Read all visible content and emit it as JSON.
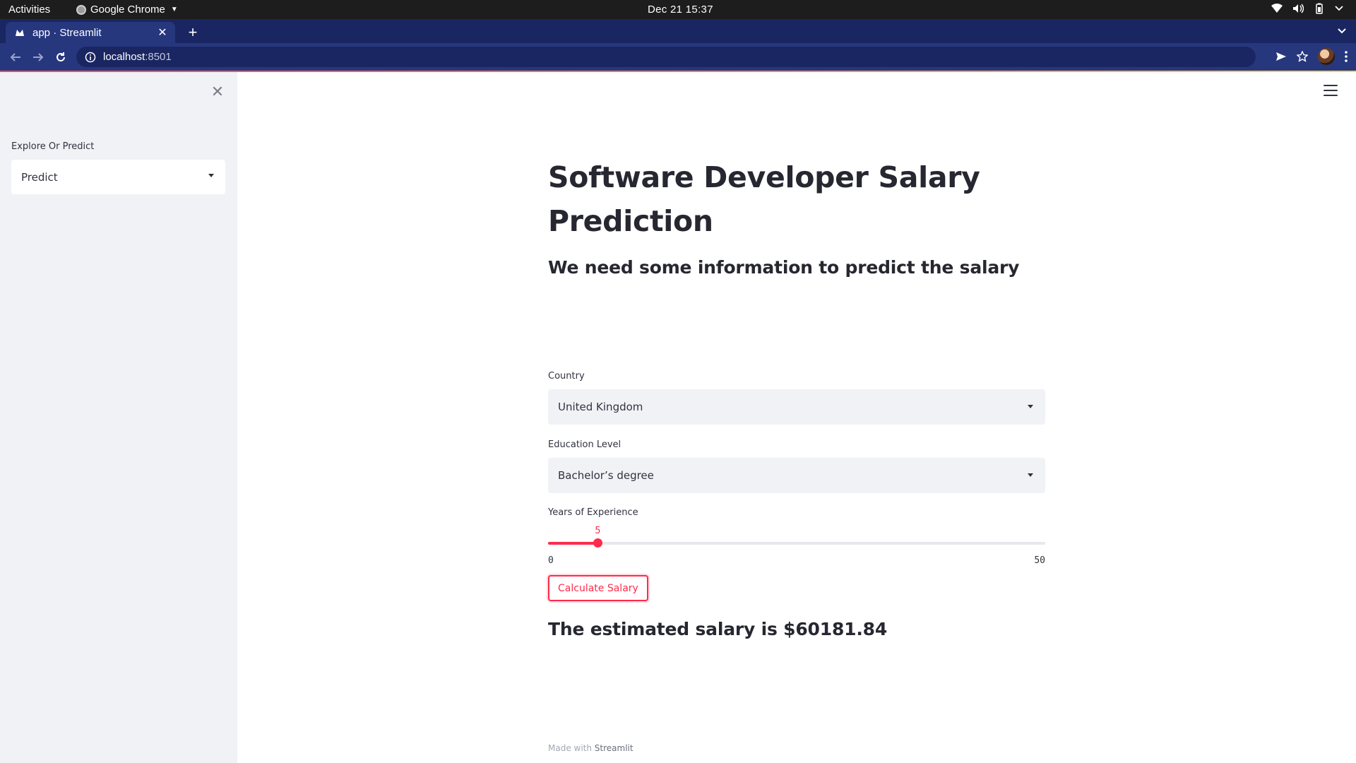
{
  "os": {
    "activities": "Activities",
    "app_name": "Google Chrome",
    "datetime": "Dec 21  15:37",
    "tray_icons": [
      "wifi-icon",
      "volume-icon",
      "battery-icon",
      "power-menu-icon"
    ]
  },
  "browser": {
    "tab_title": "app · Streamlit",
    "url_host": "localhost",
    "url_port": ":8501"
  },
  "sidebar": {
    "label": "Explore Or Predict",
    "selected": "Predict"
  },
  "main": {
    "title": "Software Developer Salary Prediction",
    "subtitle": "We need some information to predict the salary",
    "country": {
      "label": "Country",
      "value": "United Kingdom"
    },
    "education": {
      "label": "Education Level",
      "value": "Bachelor’s degree"
    },
    "experience": {
      "label": "Years of Experience",
      "value": 5,
      "min": 0,
      "max": 50,
      "value_text": "5",
      "min_text": "0",
      "max_text": "50"
    },
    "button_label": "Calculate Salary",
    "result": "The estimated salary is $60181.84"
  },
  "footer": {
    "prefix": "Made with ",
    "brand": "Streamlit"
  },
  "colors": {
    "accent": "#ff2b4b",
    "browser_frame": "#27377e",
    "tab_strip": "#1a2662",
    "sidebar_bg": "#f0f2f6"
  }
}
